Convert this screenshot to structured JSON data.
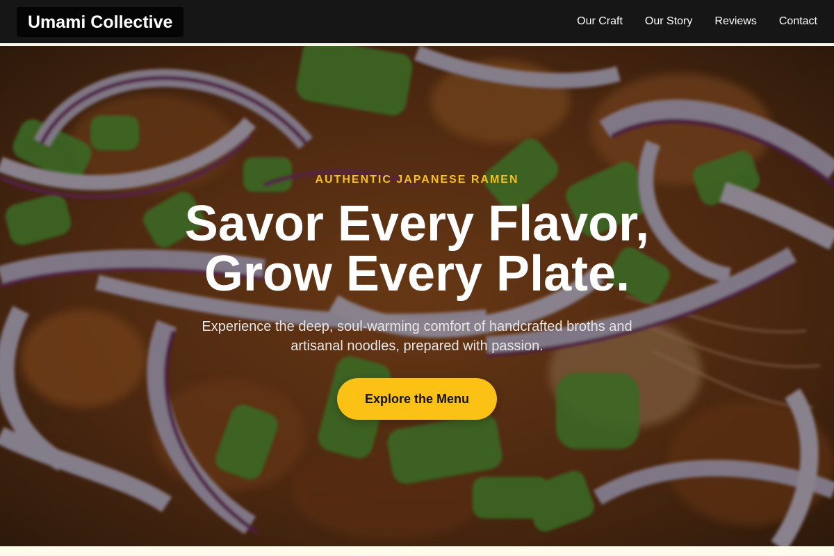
{
  "header": {
    "brand": "Umami Collective",
    "nav": [
      {
        "label": "Our Craft"
      },
      {
        "label": "Our Story"
      },
      {
        "label": "Reviews"
      },
      {
        "label": "Contact"
      }
    ]
  },
  "hero": {
    "background_image": "ramen-toppings-photo",
    "eyebrow": "AUTHENTIC JAPANESE RAMEN",
    "headline_line1": "Savor Every Flavor,",
    "headline_line2": "Grow Every Plate.",
    "subtext": "Experience the deep, soul-warming comfort of handcrafted broths and artisanal noodles, prepared with passion.",
    "cta_label": "Explore the Menu"
  },
  "colors": {
    "header_bg": "#161616",
    "accent": "#fbc114",
    "eyebrow": "#f4c11f",
    "page_bg": "#fffbea"
  }
}
